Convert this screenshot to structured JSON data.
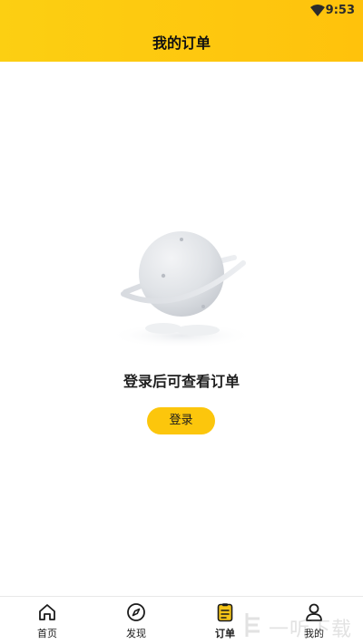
{
  "status_bar": {
    "time": "9:53",
    "wifi_icon": "wifi-icon"
  },
  "header": {
    "title": "我的订单"
  },
  "empty_state": {
    "illustration_icon": "planet-illustration",
    "message": "登录后可查看订单",
    "login_button_label": "登录"
  },
  "tab_bar": {
    "items": [
      {
        "label": "首页",
        "icon": "home-icon"
      },
      {
        "label": "发现",
        "icon": "compass-icon"
      },
      {
        "label": "订单",
        "icon": "order-clipboard-icon",
        "active": true
      },
      {
        "label": "我的",
        "icon": "user-icon"
      }
    ]
  },
  "watermark": {
    "text": "一听下载"
  },
  "colors": {
    "accent": "#FFC90E",
    "text_primary": "#1F1F1F"
  }
}
